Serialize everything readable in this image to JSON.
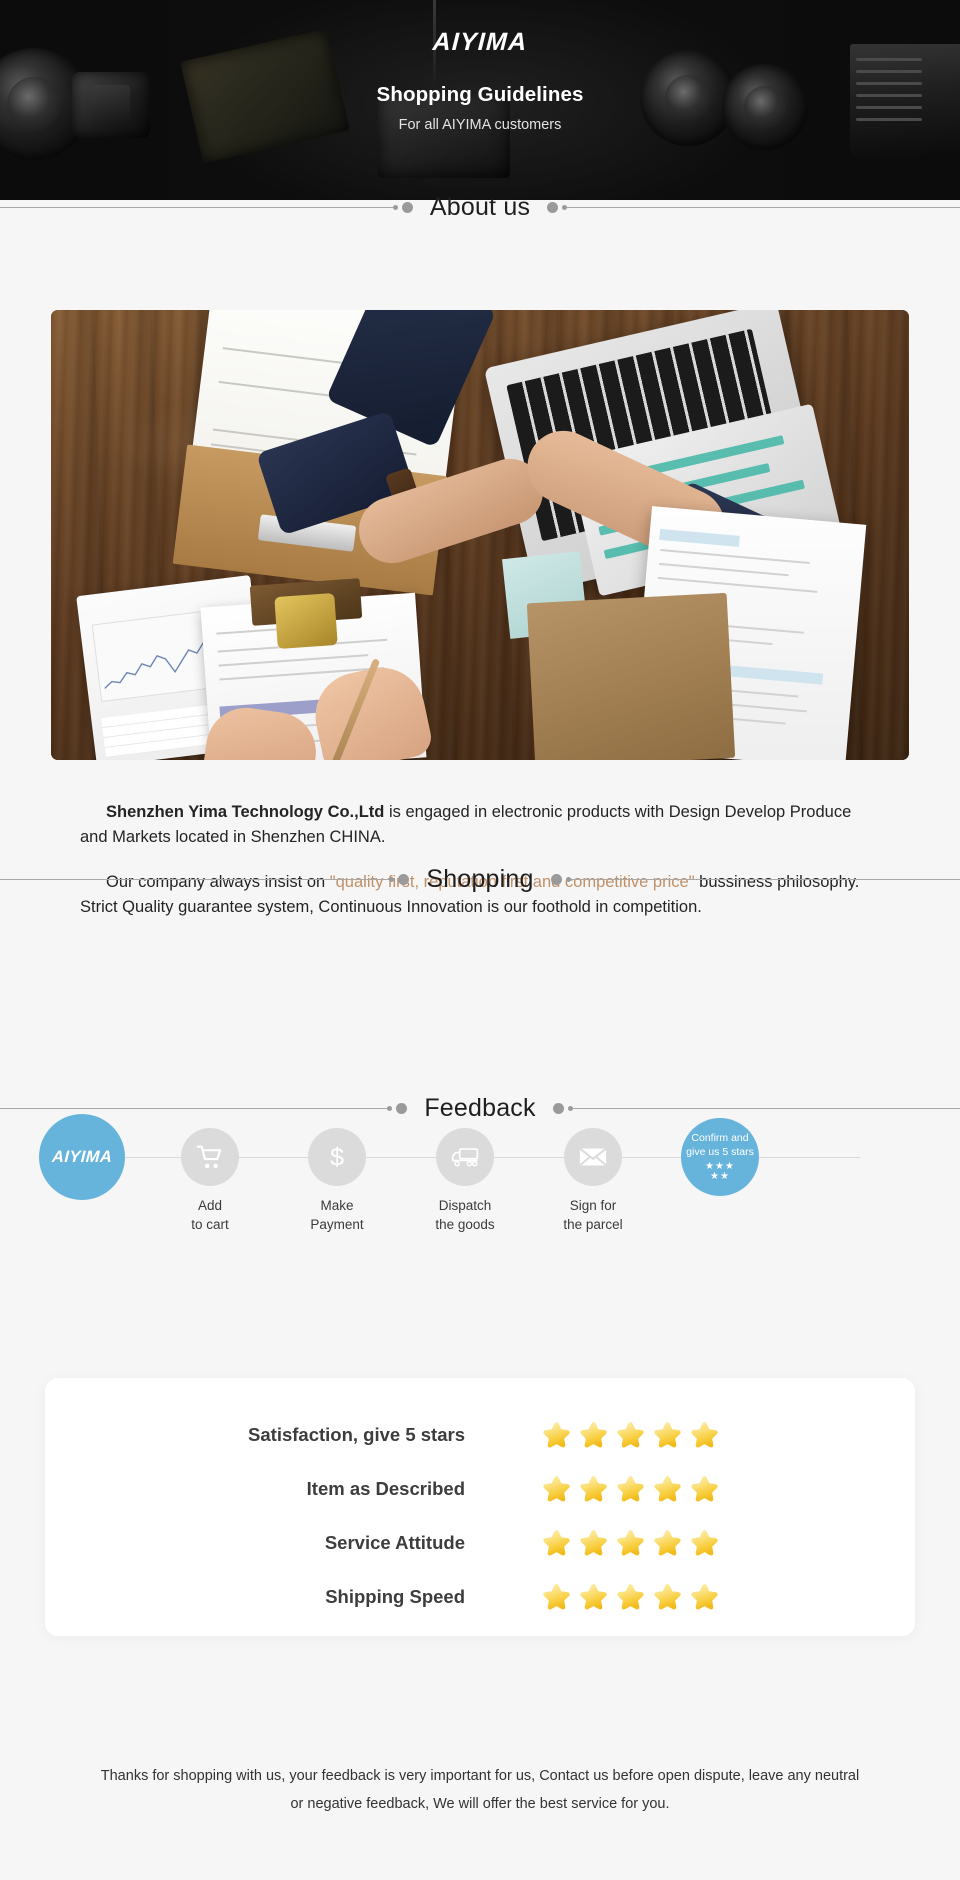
{
  "hero": {
    "logo": "AIYIMA",
    "title": "Shopping Guidelines",
    "subtitle": "For all AIYIMA customers"
  },
  "sections": {
    "about": "About us",
    "shopping": "Shopping",
    "feedback": "Feedback"
  },
  "about": {
    "paragraph1_company": "Shenzhen Yima Technology Co.,Ltd",
    "paragraph1_rest": " is engaged in electronic products with Design Develop Produce and Markets located in Shenzhen CHINA.",
    "paragraph2_lead": "Our company always insist on ",
    "paragraph2_quote": "\"quality first, reputation first and competitive price\"",
    "paragraph2_rest": " bussiness philosophy. Strict Quality guarantee system, Continuous Innovation is our foothold in competition."
  },
  "shopping": {
    "brand_label": "AIYIMA",
    "steps": [
      {
        "icon": "cart-icon",
        "label": "Add\nto cart"
      },
      {
        "icon": "dollar-icon",
        "label": "Make\nPayment"
      },
      {
        "icon": "truck-icon",
        "label": "Dispatch\nthe goods"
      },
      {
        "icon": "envelope-icon",
        "label": "Sign for\nthe parcel"
      }
    ],
    "final": {
      "text": "Confirm and\ngive us 5 stars",
      "stars_row1": "★★★",
      "stars_row2": "★★"
    }
  },
  "feedback": {
    "rows": [
      {
        "label": "Satisfaction, give 5 stars",
        "stars": 5
      },
      {
        "label": "Item as Described",
        "stars": 5
      },
      {
        "label": "Service Attitude",
        "stars": 5
      },
      {
        "label": "Shipping Speed",
        "stars": 5
      }
    ]
  },
  "footer": {
    "text": "Thanks for shopping with us, your feedback is very important for us, Contact us before open dispute, leave any neutral or negative feedback, We will offer the best service for you."
  },
  "colors": {
    "brand_blue": "#66b4dc",
    "accent_tan": "#c09068",
    "page_bg": "#f6f6f6",
    "hero_bg": "#151515",
    "circle_gray": "#dbdbdb",
    "star_gold": "#f6d045"
  }
}
